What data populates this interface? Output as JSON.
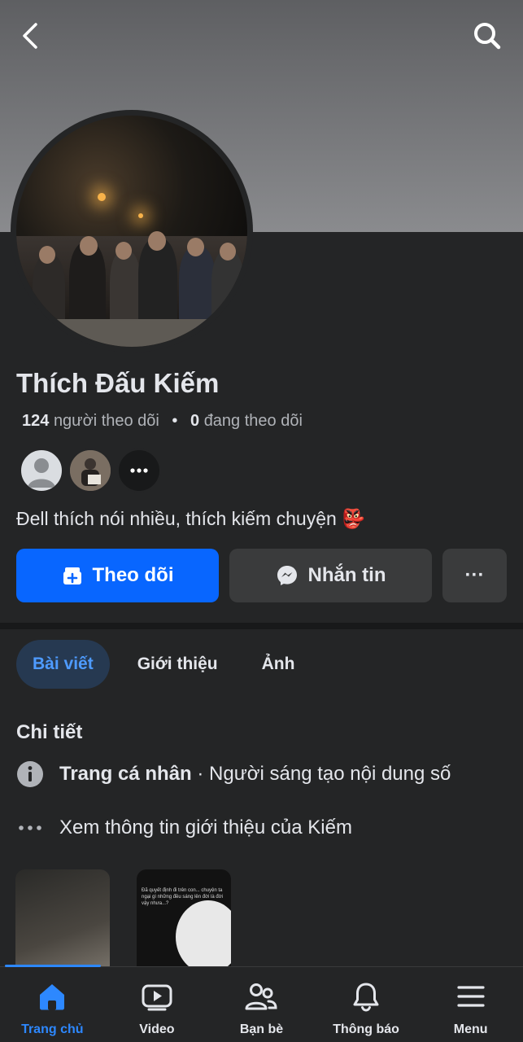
{
  "profile": {
    "name": "Thích Đấu Kiếm",
    "followers_count": "124",
    "followers_label": "người theo dõi",
    "following_count": "0",
    "following_label": "đang theo dõi",
    "bio": "Đell thích nói nhiều, thích kiếm chuyện",
    "bio_emoji": "👺"
  },
  "actions": {
    "follow_label": "Theo dõi",
    "message_label": "Nhắn tin",
    "more_label": "···"
  },
  "tabs": [
    {
      "label": "Bài viết",
      "active": true
    },
    {
      "label": "Giới thiệu",
      "active": false
    },
    {
      "label": "Ảnh",
      "active": false
    }
  ],
  "details": {
    "title": "Chi tiết",
    "page_type": "Trang cá nhân",
    "separator": " · ",
    "category": "Người sáng tạo nội dung số",
    "see_about": "Xem thông tin giới thiệu của Kiếm"
  },
  "thumb_caption": "Đã quyết định đi trên con... chuyện ta ngại gì những đều sáng lên đời là đời vậy nhưa...?",
  "bottom_nav": [
    {
      "label": "Trang chủ",
      "icon": "home-icon",
      "active": true
    },
    {
      "label": "Video",
      "icon": "video-icon",
      "active": false
    },
    {
      "label": "Bạn bè",
      "icon": "friends-icon",
      "active": false
    },
    {
      "label": "Thông báo",
      "icon": "bell-icon",
      "active": false
    },
    {
      "label": "Menu",
      "icon": "menu-icon",
      "active": false
    }
  ],
  "colors": {
    "background": "#242526",
    "accent": "#0866ff",
    "active_tab_bg": "#263951",
    "active_text": "#2d88ff"
  }
}
